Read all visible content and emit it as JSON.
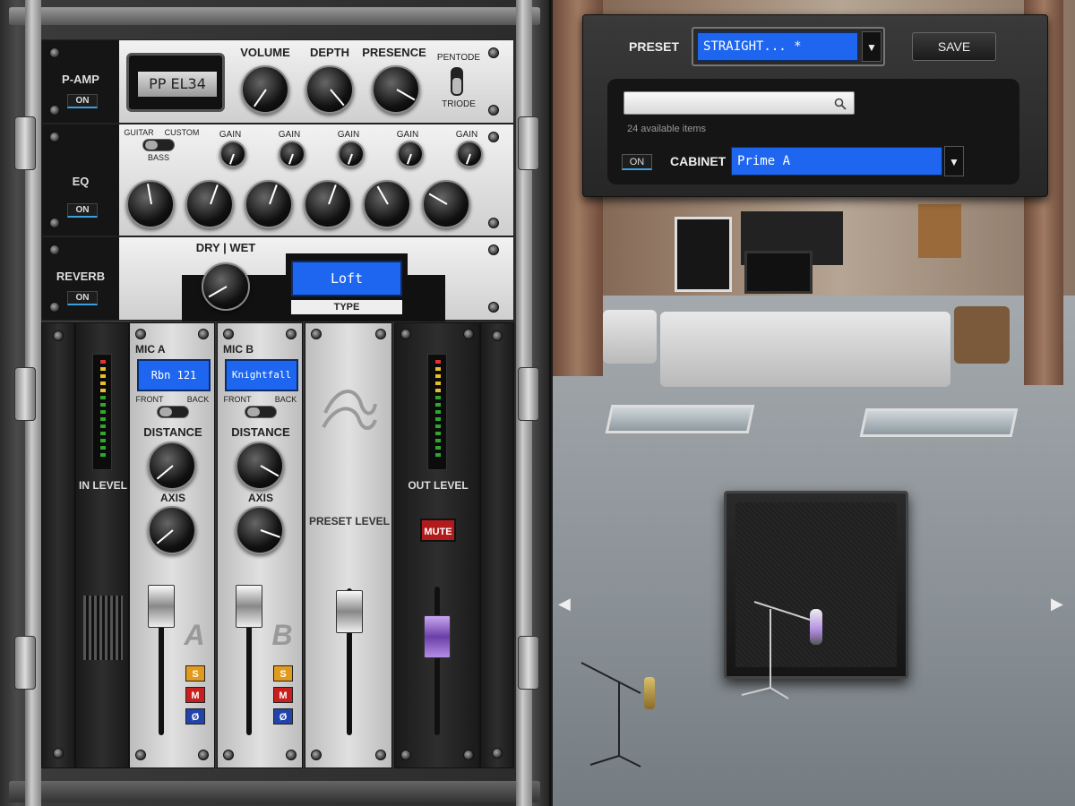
{
  "rack": {
    "pamp": {
      "label": "P-AMP",
      "on_label": "ON",
      "tube_display": "PP EL34",
      "knobs": [
        {
          "label": "VOLUME"
        },
        {
          "label": "DEPTH"
        },
        {
          "label": "PRESENCE"
        }
      ],
      "switch_top": "PENTODE",
      "switch_bottom": "TRIODE"
    },
    "eq": {
      "label": "EQ",
      "on_label": "ON",
      "mode_guitar": "GUITAR",
      "mode_custom": "CUSTOM",
      "mode_bass": "BASS",
      "gain_label": "GAIN"
    },
    "reverb": {
      "label": "REVERB",
      "on_label": "ON",
      "drywet_label": "DRY | WET",
      "type_value": "Loft",
      "type_label": "TYPE"
    },
    "in_level_label": "IN LEVEL",
    "mic_a": {
      "label": "MIC A",
      "mic": "Rbn 121",
      "front": "FRONT",
      "back": "BACK",
      "distance": "DISTANCE",
      "axis": "AXIS",
      "letter": "A"
    },
    "mic_b": {
      "label": "MIC B",
      "mic": "Knightfall",
      "front": "FRONT",
      "back": "BACK",
      "distance": "DISTANCE",
      "axis": "AXIS",
      "letter": "B"
    },
    "buttons": {
      "s": "S",
      "m": "M",
      "phase": "Ø"
    },
    "preset_level_label": "PRESET LEVEL",
    "out_level_label": "OUT LEVEL",
    "mute_label": "MUTE"
  },
  "top_panel": {
    "preset_label": "PRESET",
    "preset_value": "STRAIGHT... *",
    "save_label": "SAVE",
    "search_placeholder": "",
    "available_items": "24 available items",
    "cab_on_label": "ON",
    "cabinet_label": "CABINET",
    "cabinet_value": "Prime A"
  },
  "scene": {
    "prev_icon": "◀",
    "next_icon": "▶"
  }
}
